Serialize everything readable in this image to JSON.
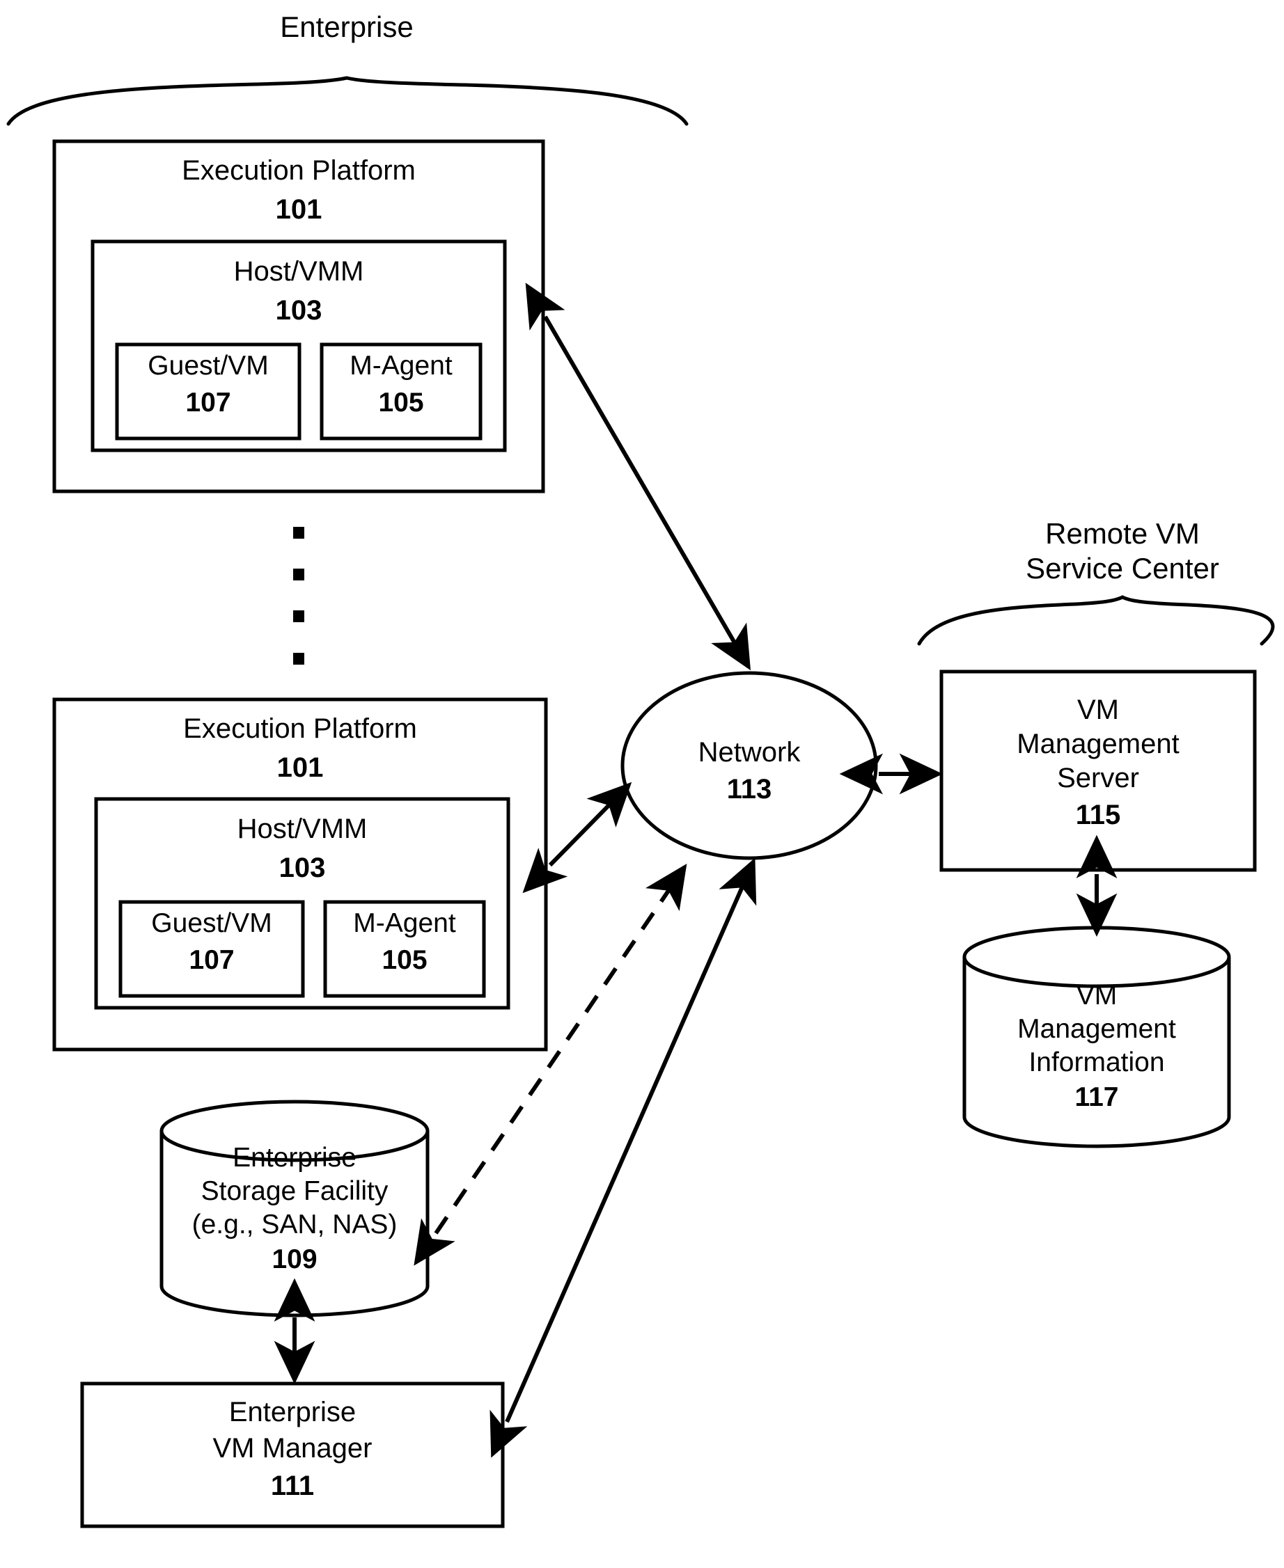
{
  "figure": {
    "type": "system-block-diagram",
    "groups": [
      {
        "id": "enterprise",
        "label": "Enterprise"
      },
      {
        "id": "remote-vm-service-center",
        "label": "Remote VM\nService Center"
      }
    ],
    "nodes": {
      "execution_platform_1": {
        "title": "Execution Platform",
        "ref": "101",
        "host": {
          "title": "Host/VMM",
          "ref": "103",
          "guest": {
            "title": "Guest/VM",
            "ref": "107"
          },
          "agent": {
            "title": "M-Agent",
            "ref": "105"
          }
        }
      },
      "execution_platform_2": {
        "title": "Execution Platform",
        "ref": "101",
        "host": {
          "title": "Host/VMM",
          "ref": "103",
          "guest": {
            "title": "Guest/VM",
            "ref": "107"
          },
          "agent": {
            "title": "M-Agent",
            "ref": "105"
          }
        }
      },
      "network": {
        "title": "Network",
        "ref": "113"
      },
      "vm_management_server": {
        "line1": "VM",
        "line2": "Management",
        "line3": "Server",
        "ref": "115"
      },
      "vm_management_information": {
        "line1": "VM",
        "line2": "Management",
        "line3": "Information",
        "ref": "117"
      },
      "enterprise_storage_facility": {
        "line1": "Enterprise",
        "line2": "Storage Facility",
        "line3": "(e.g., SAN, NAS)",
        "ref": "109"
      },
      "enterprise_vm_manager": {
        "line1": "Enterprise",
        "line2": "VM Manager",
        "ref": "111"
      }
    },
    "ellipsis": {
      "label": "vertical-ellipsis",
      "dots": 4
    },
    "connections": [
      {
        "from": "execution_platform_1",
        "to": "network",
        "style": "solid",
        "arrows": "both"
      },
      {
        "from": "execution_platform_2",
        "to": "network",
        "style": "solid",
        "arrows": "both"
      },
      {
        "from": "enterprise_storage_facility",
        "to": "network",
        "style": "dashed",
        "arrows": "both"
      },
      {
        "from": "enterprise_vm_manager",
        "to": "network",
        "style": "solid",
        "arrows": "both"
      },
      {
        "from": "network",
        "to": "vm_management_server",
        "style": "solid",
        "arrows": "both"
      },
      {
        "from": "vm_management_server",
        "to": "vm_management_information",
        "style": "solid",
        "arrows": "both"
      },
      {
        "from": "enterprise_storage_facility",
        "to": "enterprise_vm_manager",
        "style": "solid",
        "arrows": "both"
      }
    ],
    "colors": {
      "stroke": "#000000",
      "background": "#ffffff"
    }
  }
}
